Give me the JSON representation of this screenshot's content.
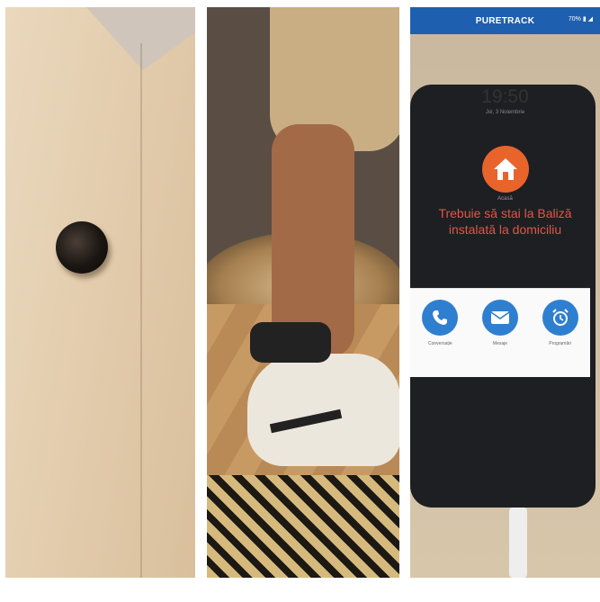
{
  "phone": {
    "app_name": "PURETRACK",
    "status": "70% ▮ ◢",
    "time": "19:50",
    "date": "Joi, 3 Noiembrie",
    "state_label": "Acasă",
    "message": "Trebuie să stai la Baliză instalată la domiciliu",
    "actions": [
      {
        "label": "Conversație",
        "icon": "phone-icon"
      },
      {
        "label": "Mesaje",
        "icon": "mail-icon"
      },
      {
        "label": "Programări",
        "icon": "alarm-clock-icon"
      }
    ],
    "colors": {
      "brand_bar": "#1f5fb0",
      "home_circle": "#e8642b",
      "message": "#e0554a",
      "action_circle": "#2f7fd1"
    }
  }
}
